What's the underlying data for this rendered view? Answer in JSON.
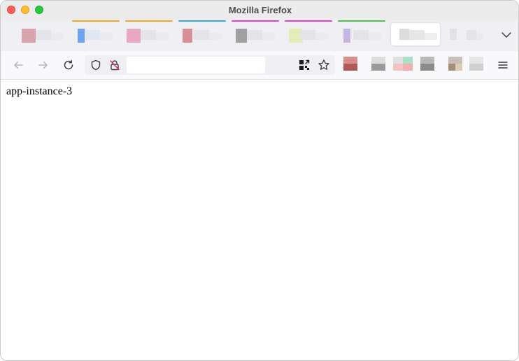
{
  "window": {
    "title": "Mozilla Firefox"
  },
  "tabs": [
    {
      "accent": null,
      "favicon_color": "#d9a3ad",
      "icon": "tab-favicon"
    },
    {
      "accent": "#f5a623",
      "favicon_color": "#6ea3f0",
      "icon": "tab-favicon"
    },
    {
      "accent": "#f5a623",
      "favicon_color": "#e9a8bf",
      "icon": "tab-favicon"
    },
    {
      "accent": "#3da8e8",
      "favicon_color": "#d88e97",
      "icon": "tab-favicon"
    },
    {
      "accent": "#e33fd9",
      "favicon_color": "#a0a0a0",
      "icon": "tab-favicon"
    },
    {
      "accent": "#e33fd9",
      "favicon_color": "#e5ecb7",
      "icon": "tab-favicon"
    },
    {
      "accent": "#4cc248",
      "favicon_color": "#c6b5e2",
      "icon": "tab-favicon"
    },
    {
      "accent": null,
      "favicon_color": "#dcdcdc",
      "icon": "tab-favicon",
      "selected": true
    },
    {
      "accent": null,
      "favicon_color": "#e2e2e6",
      "icon": "tab-favicon"
    }
  ],
  "urlbar": {
    "value": "",
    "placeholder": ""
  },
  "bookmarks": [
    {
      "colors": [
        "#d98c8c",
        "#b05858"
      ]
    },
    {
      "colors": [
        "#c8c8c8",
        "#9a9a9a"
      ]
    },
    {
      "colors": [
        "#a8e0c8",
        "#f0b0b0"
      ]
    },
    {
      "colors": [
        "#b8b8b8",
        "#8a8a8a"
      ]
    },
    {
      "colors": [
        "#c8c0b8",
        "#a88e70"
      ]
    },
    {
      "colors": [
        "#d8d8d8",
        "#c0c0c0"
      ]
    }
  ],
  "content": {
    "text": "app-instance-3"
  }
}
